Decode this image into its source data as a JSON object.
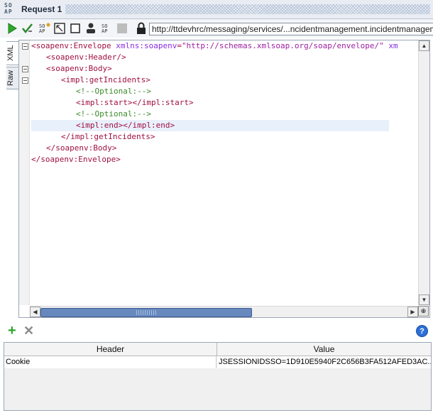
{
  "window": {
    "logo_top": "SO",
    "logo_bottom": "AP",
    "title": "Request 1"
  },
  "toolbar": {
    "url": "http://ttdevhrc/messaging/services/...ncidentmanagement.incidentmanagem",
    "icons": [
      "run-icon",
      "validate-icon",
      "soap-create-icon",
      "fullscreen-icon",
      "stop-box-icon",
      "user-icon",
      "soap-icon",
      "stop-icon",
      "lock-icon"
    ]
  },
  "tabs": {
    "xml": "XML",
    "raw": "Raw"
  },
  "xml": {
    "l1_tag": "soapenv:Envelope",
    "l1_attr": "xmlns:soapenv",
    "l1_val": "\"http://schemas.xmlsoap.org/soap/envelope/\"",
    "l1_attr2": "xm",
    "l2": "soapenv:Header/",
    "l3": "soapenv:Body",
    "l4": "impl:getIncidents",
    "l5": "<!--Optional:-->",
    "l6_open": "impl:start",
    "l6_close": "/impl:start",
    "l7": "<!--Optional:-->",
    "l8_open": "impl:end",
    "l8_close": "/impl:end",
    "l9": "/impl:getIncidents",
    "l10": "/soapenv:Body",
    "l11": "/soapenv:Envelope"
  },
  "headers": {
    "col_header": "Header",
    "col_value": "Value",
    "rows": [
      {
        "name": "Cookie",
        "value": "JSESSIONIDSSO=1D910E5940F2C656B3FA512AFED3AC..."
      }
    ]
  },
  "colors": {
    "tag": "#a01040",
    "attr": "#8a2be2",
    "value": "#9d20a0",
    "comment": "#3a8a2a",
    "scroll_thumb": "#6889bd"
  }
}
